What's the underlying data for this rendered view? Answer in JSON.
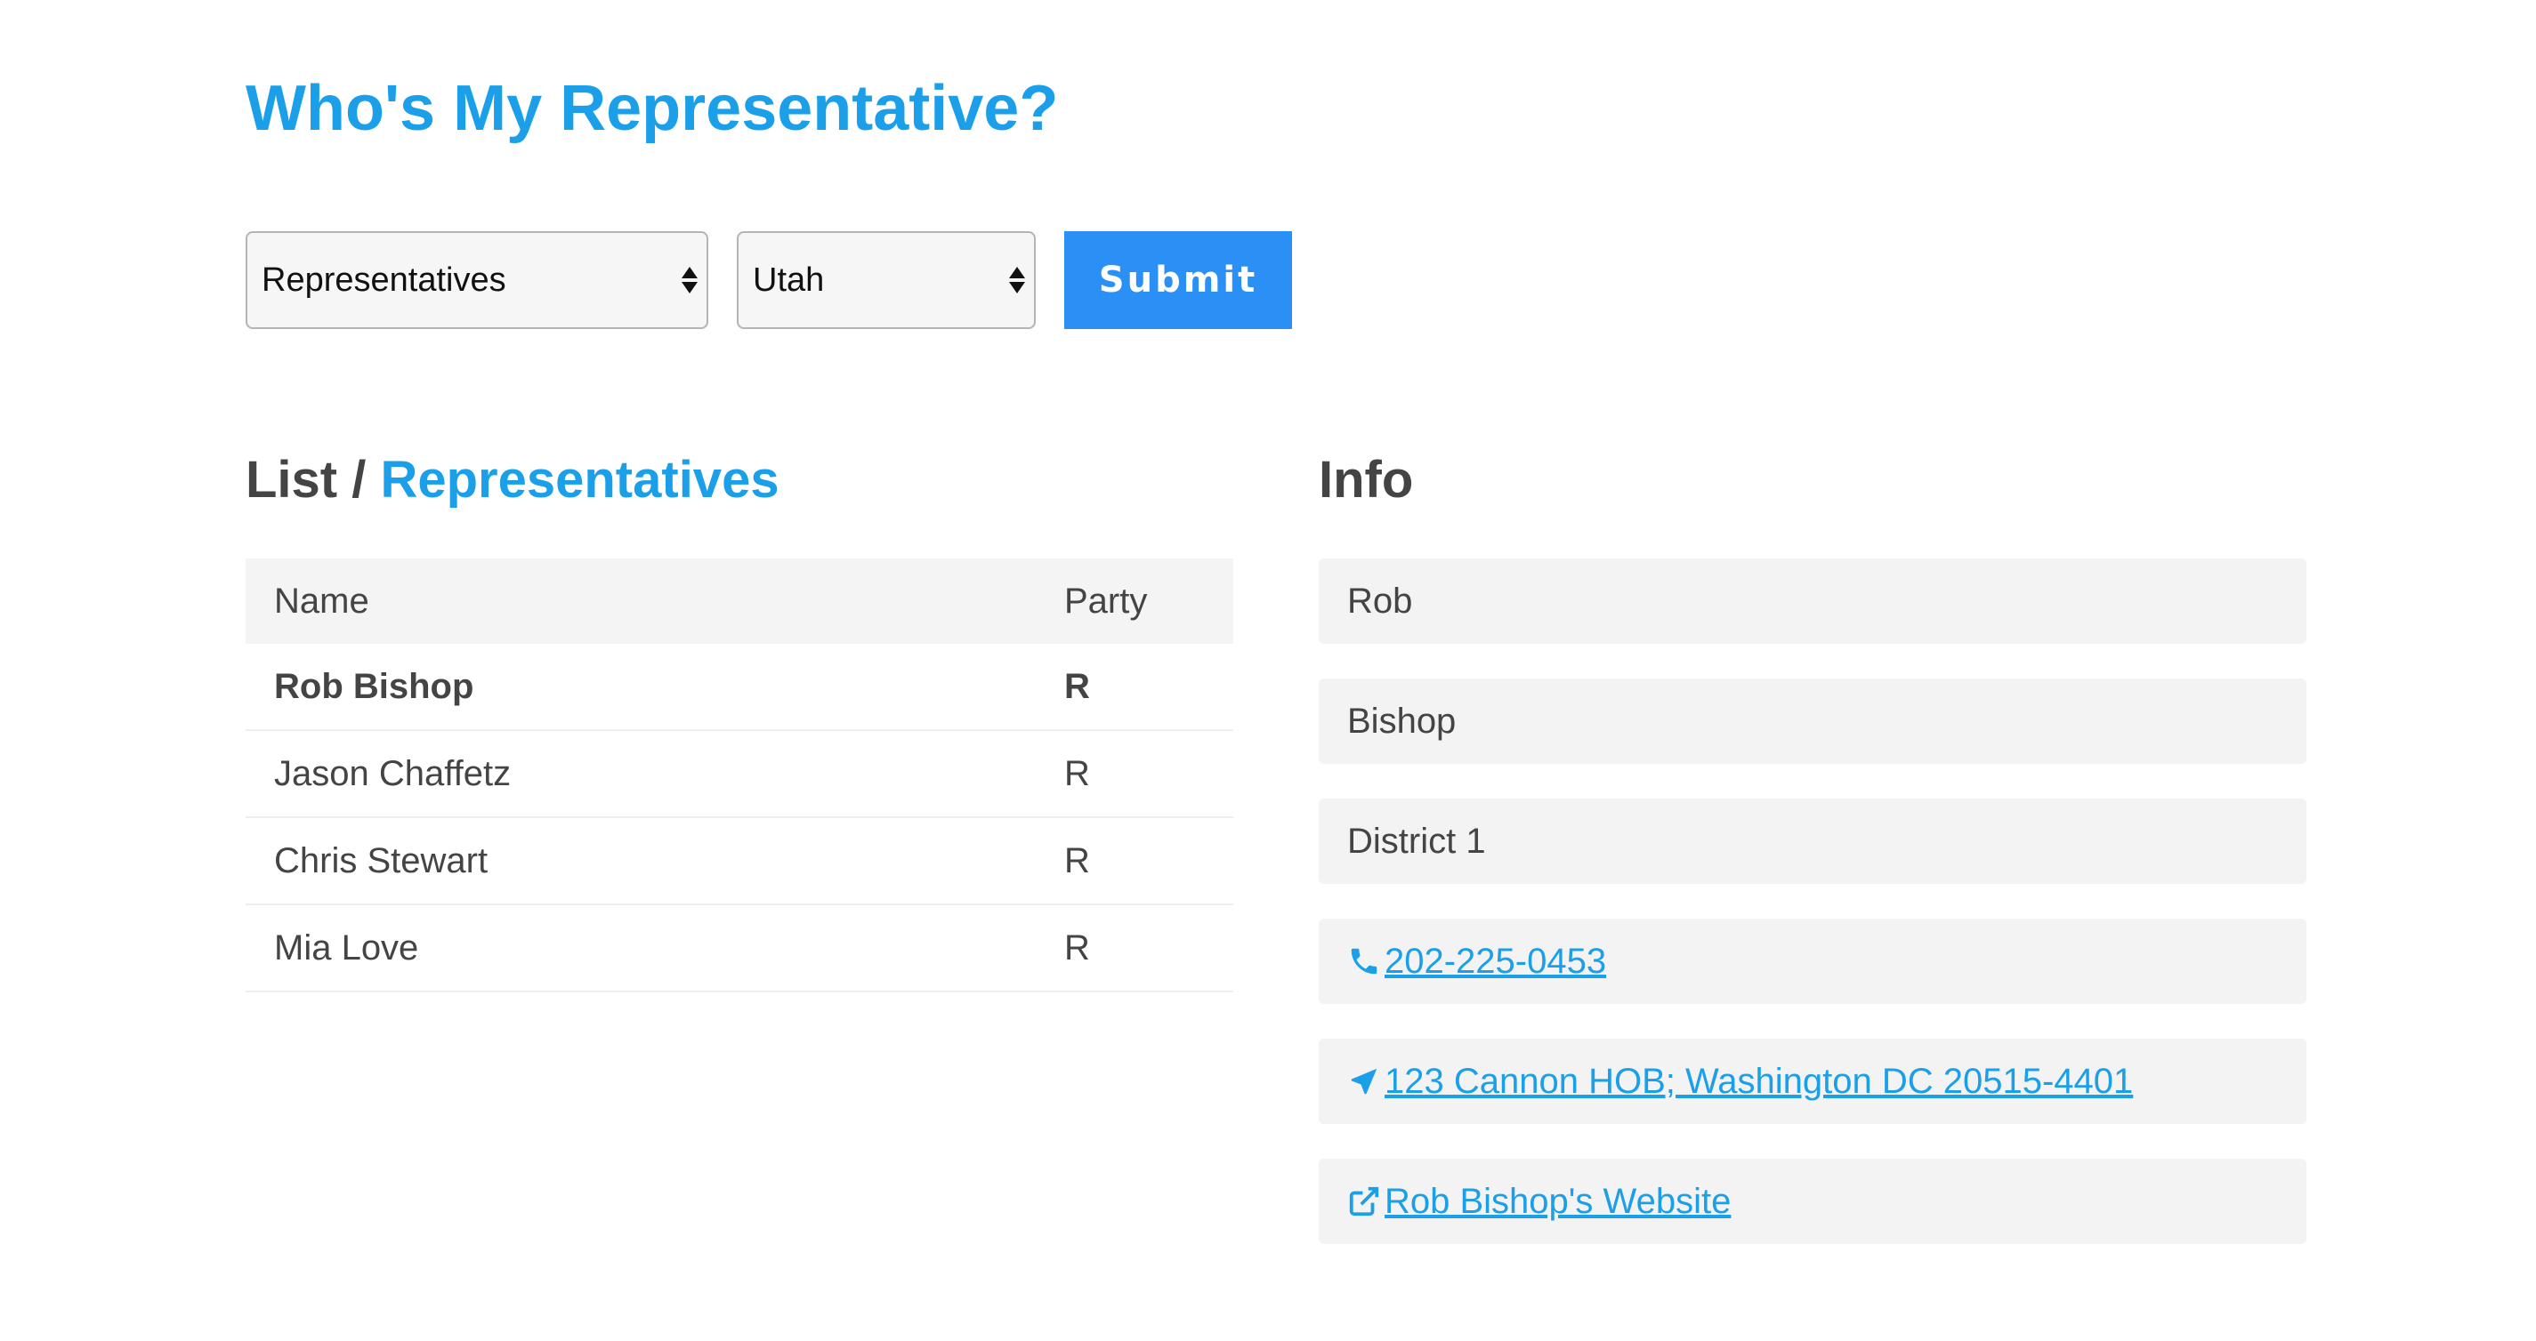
{
  "title": "Who's My Representative?",
  "form": {
    "type_select": {
      "selected": "Representatives"
    },
    "state_select": {
      "selected": "Utah"
    },
    "submit_label": "Submit"
  },
  "list": {
    "heading_prefix": "List /",
    "heading_accent": "Representatives",
    "columns": [
      "Name",
      "Party"
    ],
    "rows": [
      {
        "name": "Rob Bishop",
        "party": "R",
        "selected": true
      },
      {
        "name": "Jason Chaffetz",
        "party": "R",
        "selected": false
      },
      {
        "name": "Chris Stewart",
        "party": "R",
        "selected": false
      },
      {
        "name": "Mia Love",
        "party": "R",
        "selected": false
      }
    ]
  },
  "info": {
    "heading": "Info",
    "first_name": "Rob",
    "last_name": "Bishop",
    "district": "District 1",
    "phone": " 202-225-0453",
    "address": " 123 Cannon HOB; Washington DC 20515-4401",
    "website": " Rob Bishop's Website",
    "icons": {
      "phone": "phone-icon",
      "address": "location-arrow-icon",
      "website": "external-link-icon"
    }
  },
  "colors": {
    "accent": "#1a9fe8",
    "button": "#2b90f5",
    "text": "#444444",
    "panel": "#f3f3f3"
  }
}
